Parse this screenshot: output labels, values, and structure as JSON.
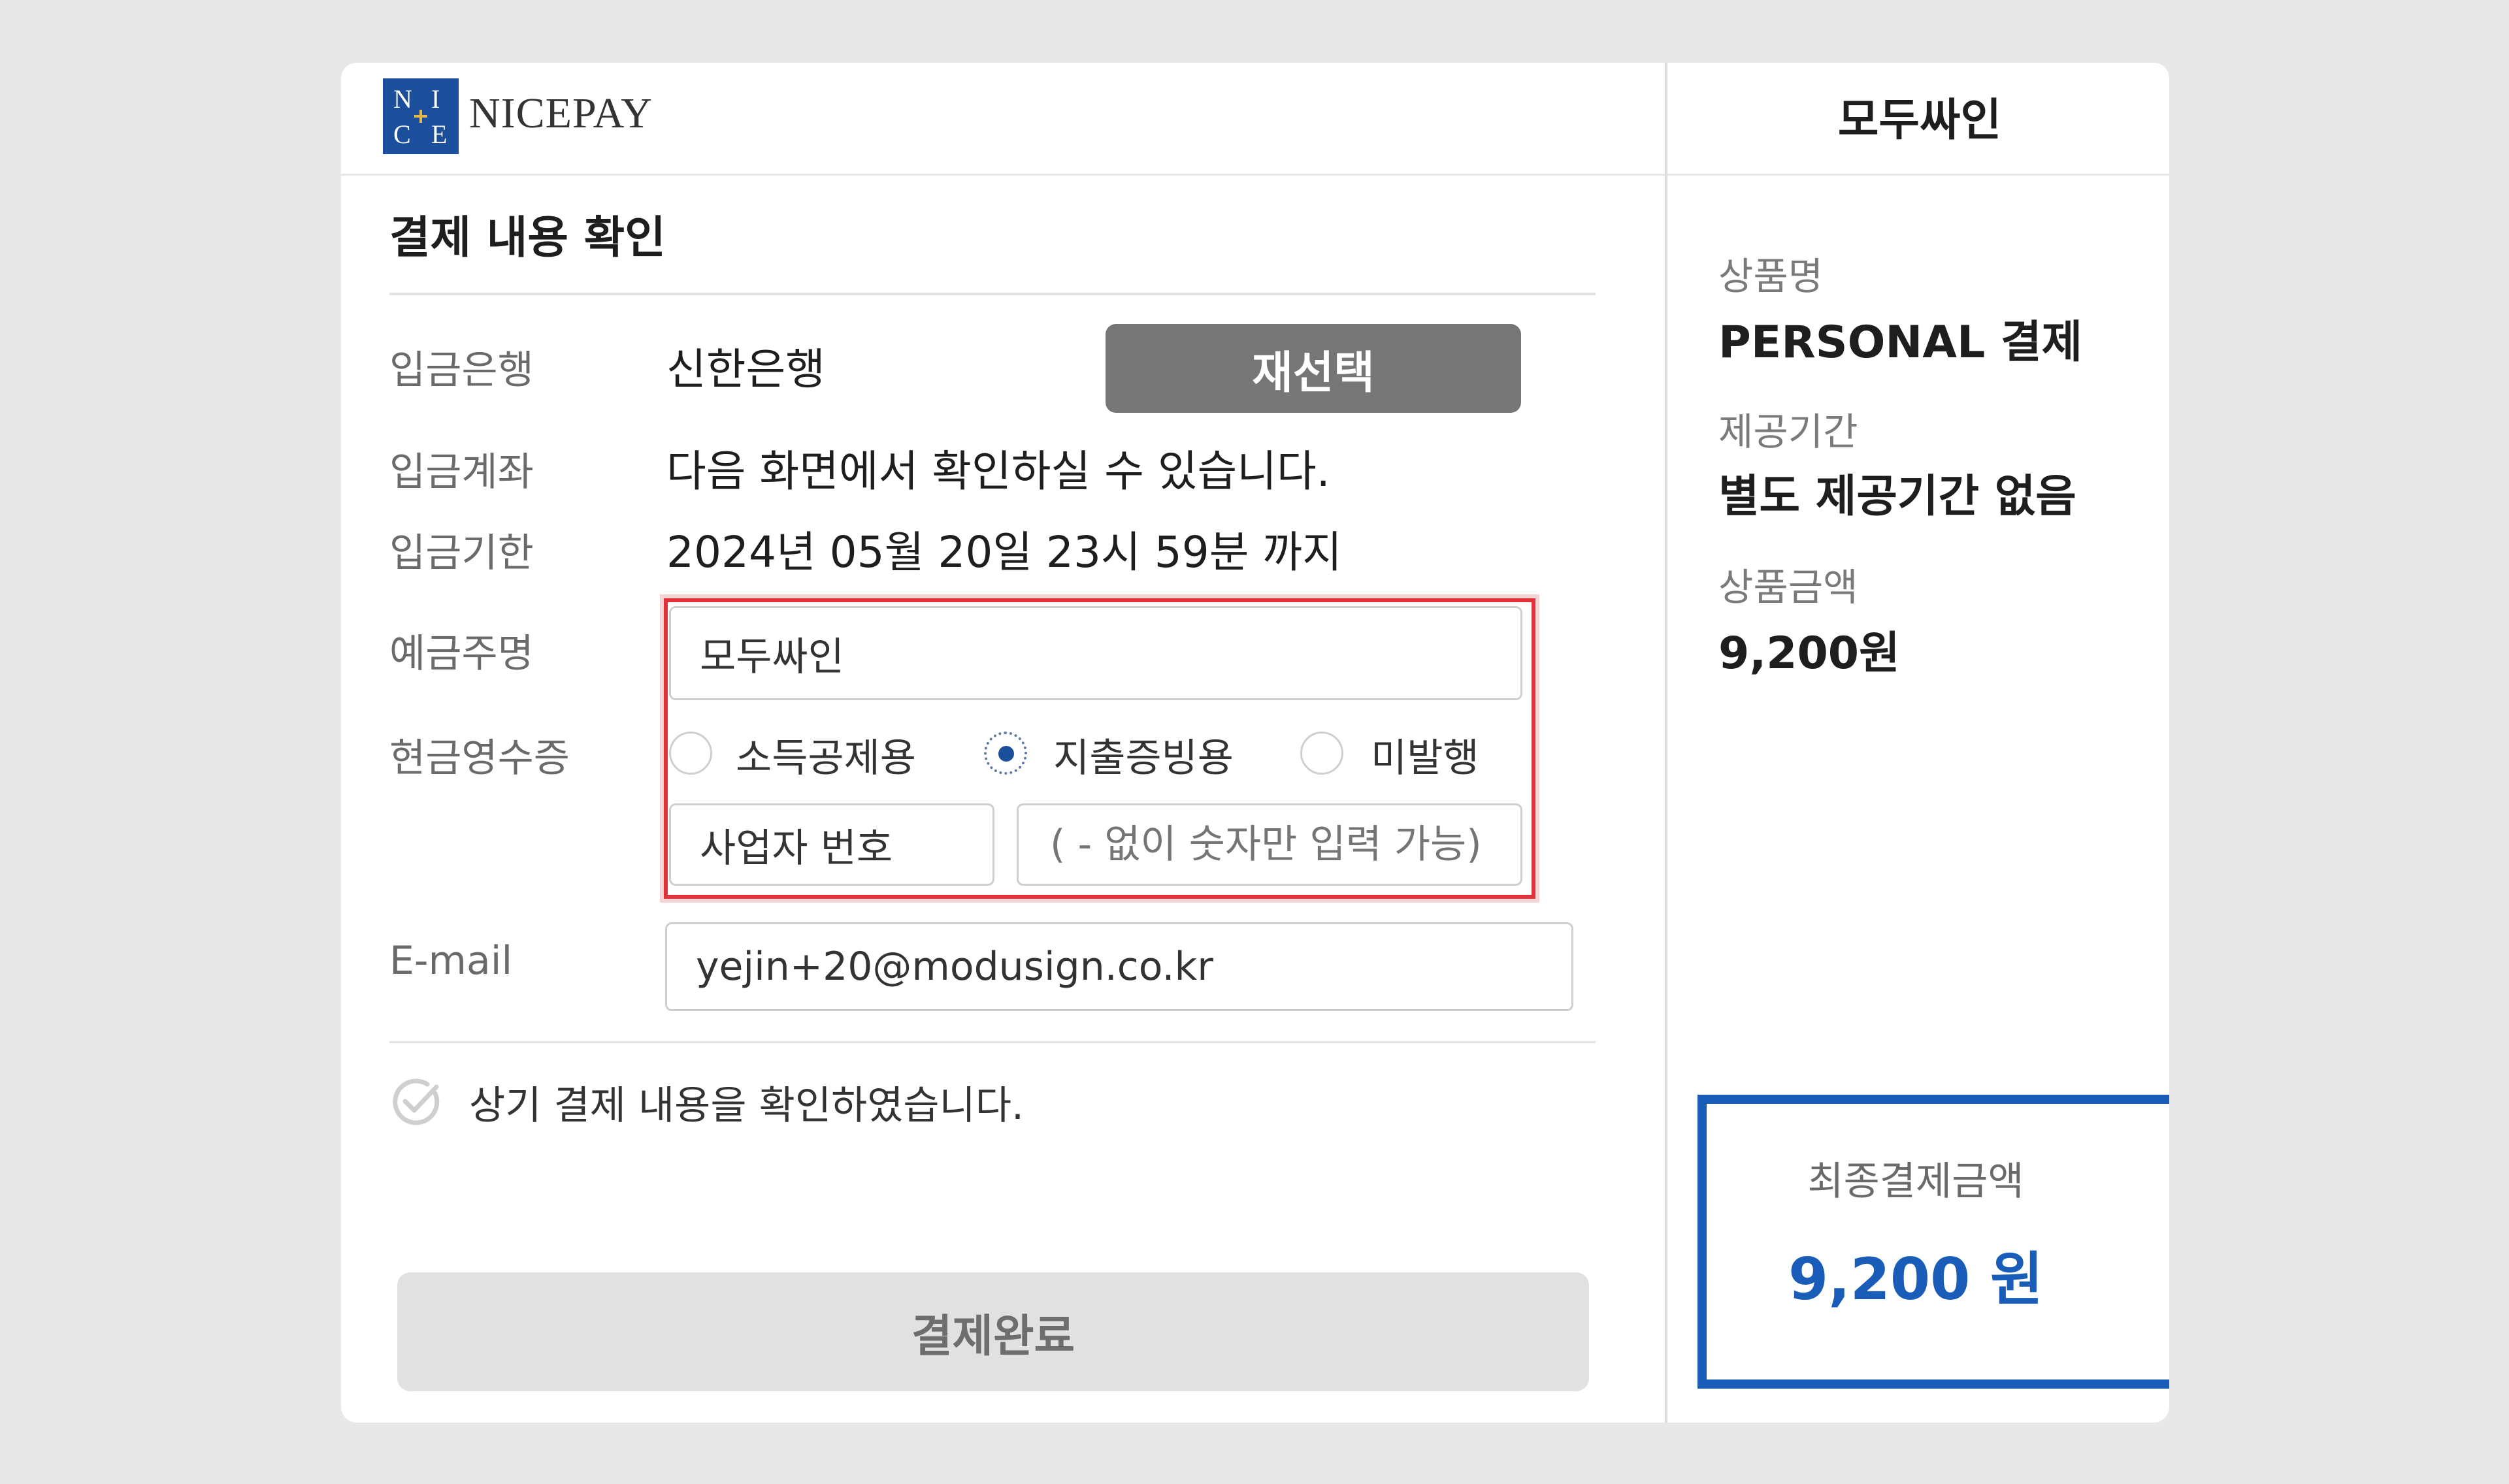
{
  "header": {
    "logo_letters": [
      "N",
      "I",
      "C",
      "E"
    ],
    "logo_text": "NICEPAY",
    "merchant": "모두싸인"
  },
  "main": {
    "title": "결제 내용 확인",
    "bank": {
      "label": "입금은행",
      "value": "신한은행",
      "reselect_label": "재선택"
    },
    "account": {
      "label": "입금계좌",
      "value": "다음 화면에서 확인하실 수 있습니다."
    },
    "deadline": {
      "label": "입금기한",
      "value": "2024년 05월 20일 23시 59분 까지"
    },
    "depositor": {
      "label": "예금주명",
      "value": "모두싸인"
    },
    "receipt": {
      "label": "현금영수증",
      "options": [
        "소득공제용",
        "지출증빙용",
        "미발행"
      ],
      "selected": "지출증빙용",
      "type_value": "사업자 번호",
      "number_placeholder": "( - 없이 숫자만 입력 가능)"
    },
    "email": {
      "label": "E-mail",
      "value": "yejin+20@modusign.co.kr"
    },
    "confirm_text": "상기 결제 내용을 확인하였습니다.",
    "complete_label": "결제완료"
  },
  "summary": {
    "product_label": "상품명",
    "product_value": "PERSONAL 결제",
    "period_label": "제공기간",
    "period_value": "별도 제공기간 없음",
    "price_label": "상품금액",
    "price_value": "9,200원",
    "final_label": "최종결제금액",
    "final_value": "9,200 원"
  },
  "colors": {
    "accent": "#1a5db8",
    "highlight": "#e0323a",
    "button_gray": "#767676"
  }
}
